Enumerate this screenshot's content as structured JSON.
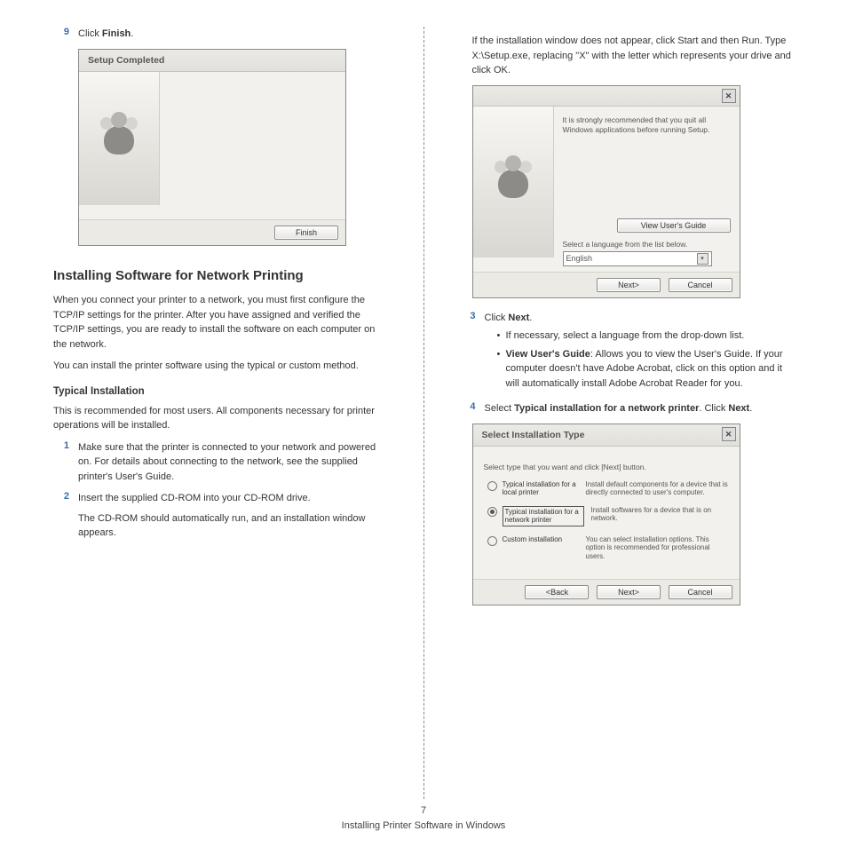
{
  "left": {
    "step9": {
      "num": "9",
      "text_a": "Click ",
      "text_b": "Finish",
      "text_c": "."
    },
    "wizard1": {
      "title": "Setup Completed",
      "finish_btn": "Finish"
    },
    "heading": "Installing Software for Network Printing",
    "para1": "When you connect your printer to a network, you must first configure the TCP/IP settings for the printer. After you have assigned and verified the TCP/IP settings, you are ready to install the software on each computer on the network.",
    "para2": "You can install the printer software using the typical or custom method.",
    "subhead": "Typical Installation",
    "para3": "This is recommended for most users. All components necessary for printer operations will be installed.",
    "step1": {
      "num": "1",
      "text": "Make sure that the printer is connected to your network and powered on. For details about connecting to the network, see the supplied printer's User's Guide."
    },
    "step2": {
      "num": "2",
      "text_a": "Insert the supplied CD-ROM into your CD-ROM drive.",
      "text_b": "The CD-ROM should automatically run, and an installation window appears."
    }
  },
  "right": {
    "intro": {
      "a": "If the installation window does not appear, click ",
      "b": "Start",
      "c": " and then ",
      "d": "Run",
      "e": ". Type ",
      "f": "X:\\Setup.exe",
      "g": ", replacing \"",
      "h": "X",
      "i": "\" with the letter which represents your drive and click ",
      "j": "OK",
      "k": "."
    },
    "wizard2": {
      "msg": "It is strongly recommended that you quit all Windows applications before running Setup.",
      "view_guide_btn": "View User's Guide",
      "lang_label": "Select a language from the list below.",
      "lang_value": "English",
      "next_btn": "Next>",
      "cancel_btn": "Cancel"
    },
    "step3": {
      "num": "3",
      "text_a": "Click ",
      "text_b": "Next",
      "text_c": ".",
      "bullet1": "If necessary, select a language from the drop-down list.",
      "bullet2_a": "View User's Guide",
      "bullet2_b": ": Allows you to view the User's Guide. If your computer doesn't have Adobe Acrobat, click on this option and it will automatically install Adobe Acrobat Reader for you."
    },
    "step4": {
      "num": "4",
      "text_a": "Select ",
      "text_b": "Typical installation for a network printer",
      "text_c": ". Click ",
      "text_d": "Next",
      "text_e": "."
    },
    "wizard3": {
      "title": "Select Installation Type",
      "hint": "Select type that you want and click [Next] button.",
      "opt1_label": "Typical installation for a local printer",
      "opt1_desc": "Install default components for a device that is directly connected to user's computer.",
      "opt2_label": "Typical installation for a network printer",
      "opt2_desc": "Install softwares for a device that is on network.",
      "opt3_label": "Custom installation",
      "opt3_desc": "You can select installation options. This option is recommended for professional users.",
      "back_btn": "<Back",
      "next_btn": "Next>",
      "cancel_btn": "Cancel"
    }
  },
  "footer": {
    "pagenum": "7",
    "caption": "Installing Printer Software in Windows"
  }
}
